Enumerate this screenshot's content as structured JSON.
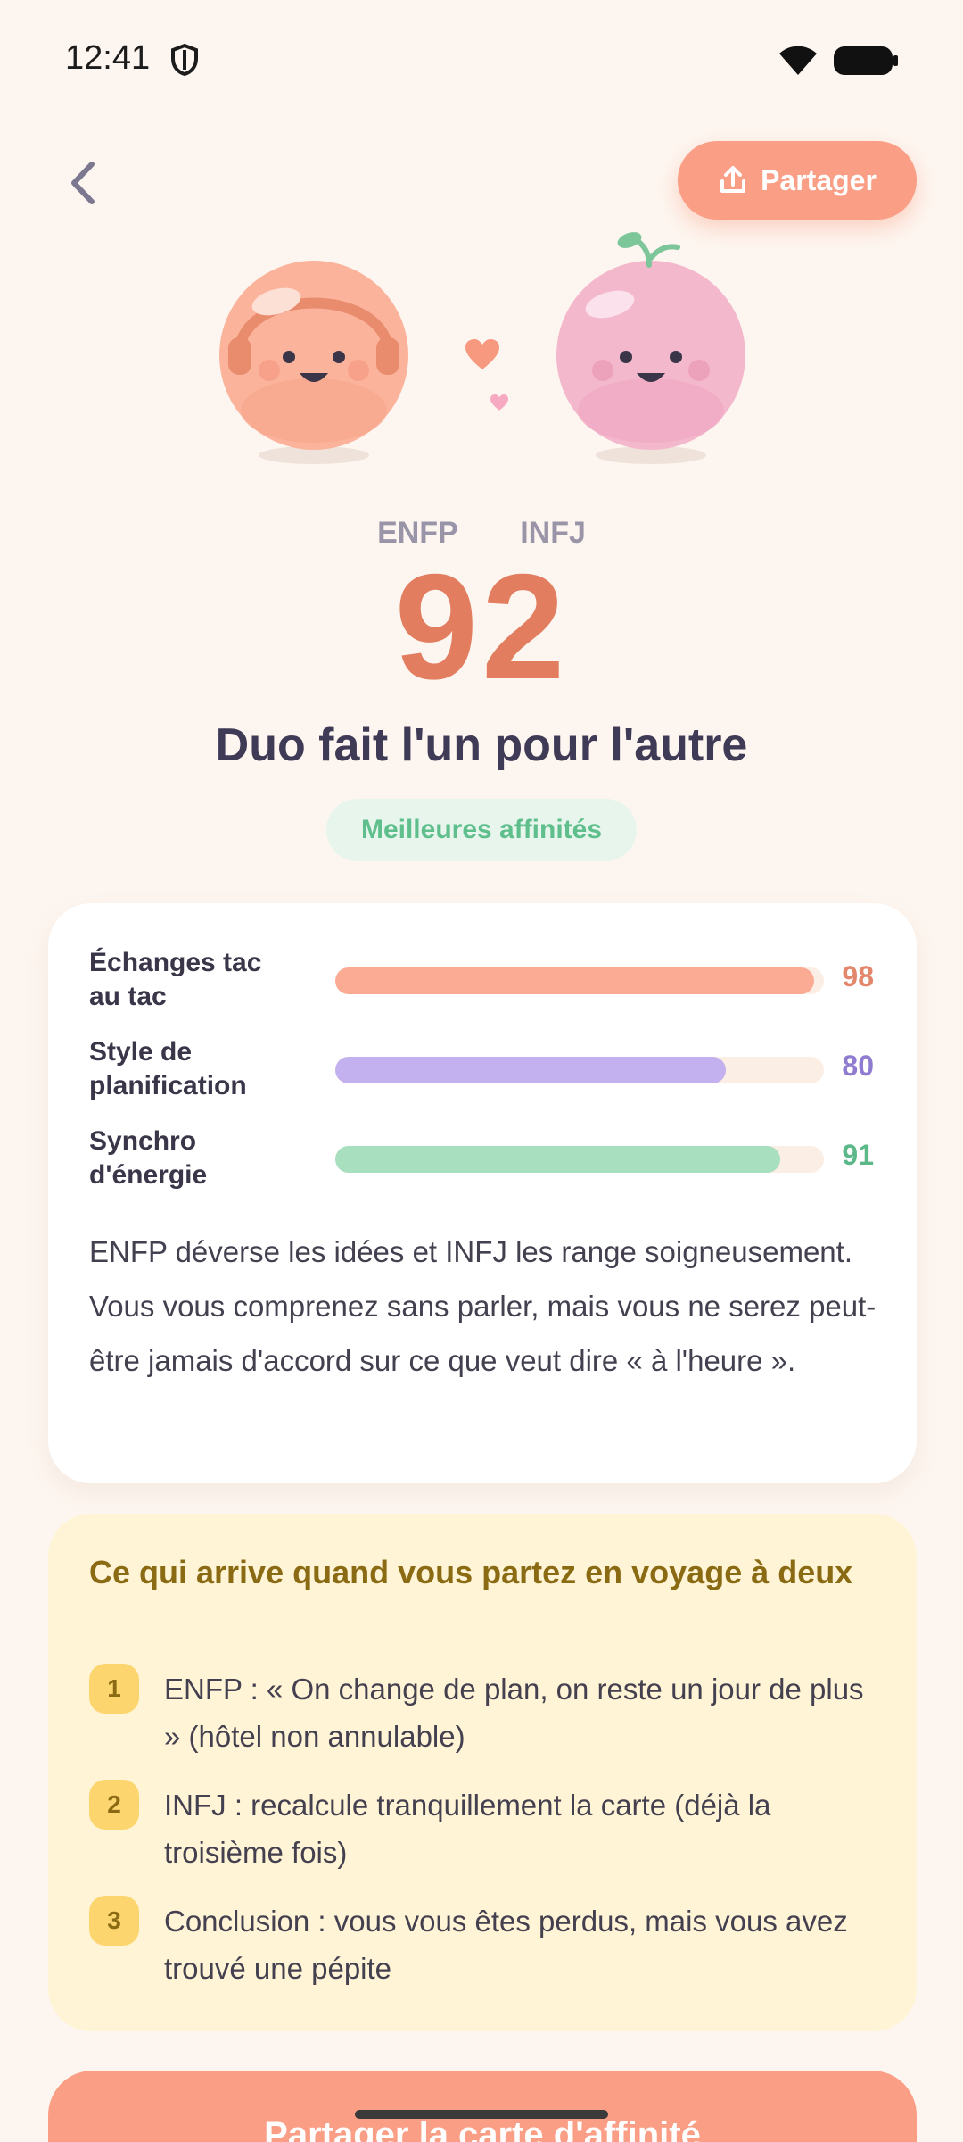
{
  "status_bar": {
    "time": "12:41"
  },
  "header": {
    "share_label": "Partager"
  },
  "result": {
    "type_left": "ENFP",
    "type_right": "INFJ",
    "score": "92",
    "title": "Duo fait l'un pour l'autre",
    "badge": "Meilleures affinités"
  },
  "metrics": [
    {
      "label": "Échanges tac au tac",
      "value": "98",
      "fraction": 0.98,
      "color": "#fbab94",
      "value_color": "#e2876c"
    },
    {
      "label": "Style de planification",
      "value": "80",
      "fraction": 0.8,
      "color": "#c3b0ee",
      "value_color": "#8f7bd0"
    },
    {
      "label": "Synchro d'énergie",
      "value": "91",
      "fraction": 0.91,
      "color": "#a7dfbf",
      "value_color": "#5cb889"
    }
  ],
  "description": "ENFP déverse les idées et INFJ les range soigneusement. Vous vous comprenez sans parler, mais vous ne serez peut-être jamais d'accord sur ce que veut dire « à l'heure ».",
  "trip": {
    "title": "Ce qui arrive quand vous partez en voyage à deux",
    "items": [
      {
        "num": "1",
        "text": "ENFP : « On change de plan, on reste un jour de plus » (hôtel non annulable)"
      },
      {
        "num": "2",
        "text": "INFJ : recalcule tranquillement la carte (déjà la troisième fois)"
      },
      {
        "num": "3",
        "text": "Conclusion : vous vous êtes perdus, mais vous avez trouvé une pépite"
      }
    ]
  },
  "cta": {
    "label": "Partager la carte d'affinité"
  }
}
